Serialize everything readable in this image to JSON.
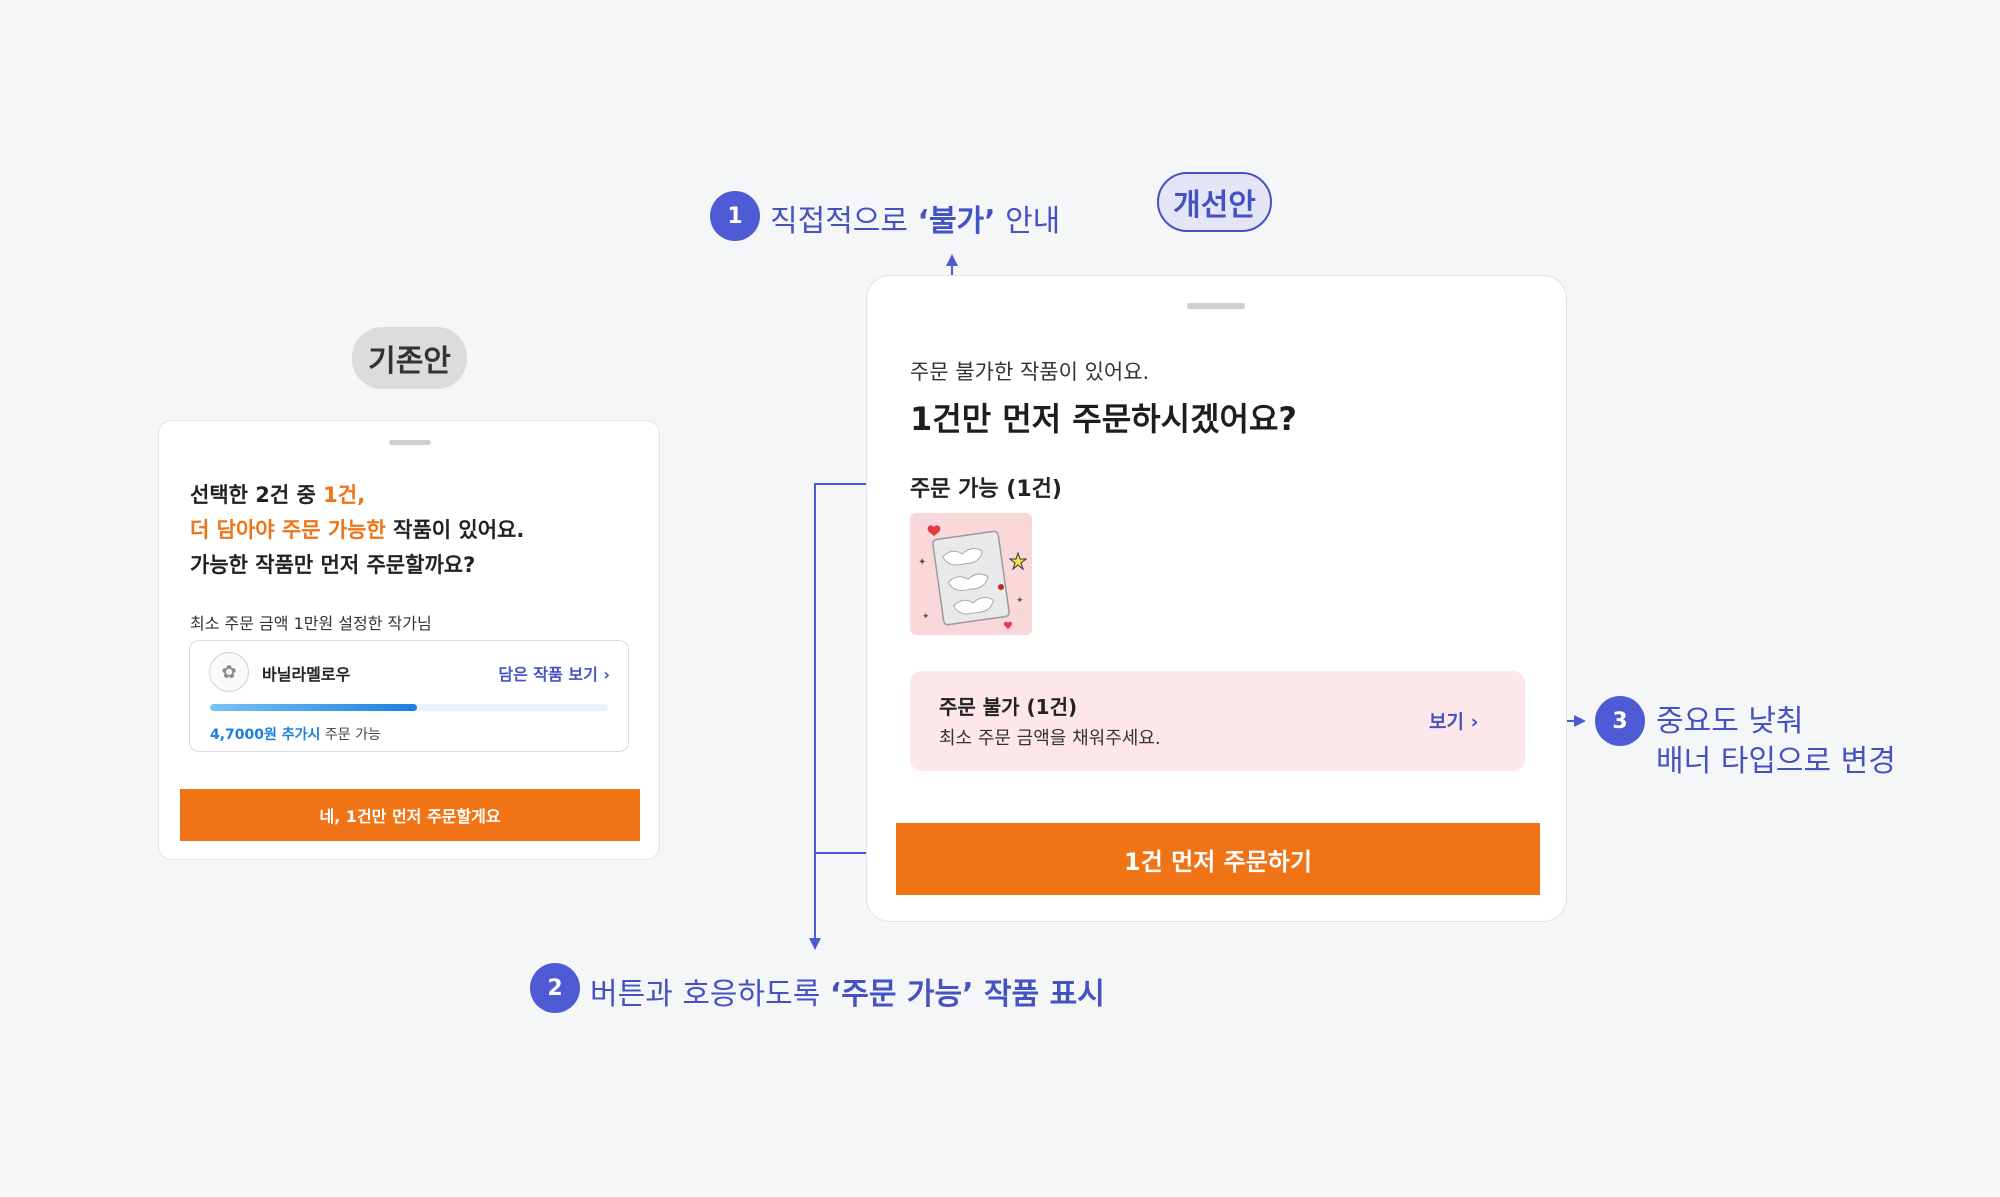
{
  "labels": {
    "old": "기존안",
    "new": "개선안"
  },
  "old_card": {
    "line1_a": "선택한 2건 중 ",
    "line1_b": "1건,",
    "line2_a": "더 담아야 주문 가능한",
    "line2_b": " 작품이 있어요.",
    "line3": "가능한 작품만 먼저 주문할까요?",
    "sub": "최소 주문 금액 1만원 설정한 작가님",
    "seller_name": "바닐라멜로우",
    "seller_link": "담은 작품 보기 ›",
    "progress_fraction": 0.52,
    "note_strong": "4,7000원 추가시",
    "note_rest": " 주문 가능",
    "button": "네, 1건만 먼저 주문할게요"
  },
  "new_card": {
    "sub": "주문 불가한 작품이 있어요.",
    "title": "1건만 먼저 주문하시겠어요?",
    "available_heading": "주문 가능 (1건)",
    "banner_title": "주문 불가 (1건)",
    "banner_desc": "최소 주문 금액을 채워주세요.",
    "banner_link": "보기 ›",
    "button": "1건 먼저 주문하기"
  },
  "annotations": {
    "a1": {
      "num": "1",
      "pre": "직접적으로 ",
      "strong": "‘불가’",
      "post": " 안내"
    },
    "a2": {
      "num": "2",
      "pre": "버튼과 호응하도록 ",
      "strong": "‘주문 가능’ 작품 표시"
    },
    "a3": {
      "num": "3",
      "line1": "중요도 낮춰",
      "line2": "배너 타입으로 변경"
    }
  },
  "colors": {
    "accent": "#4452c2",
    "orange": "#f07316",
    "banner_bg": "#fde7ea"
  }
}
